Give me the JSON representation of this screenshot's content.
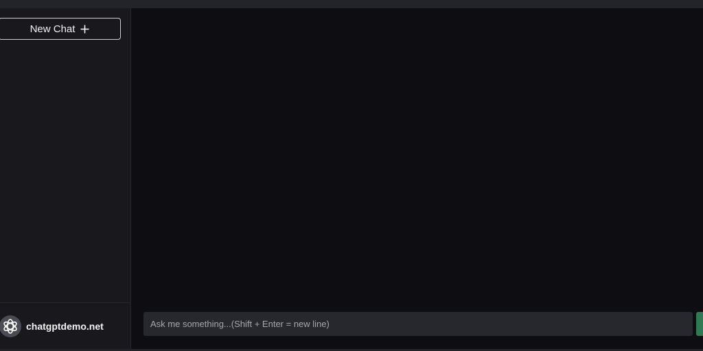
{
  "sidebar": {
    "new_chat_label": "New Chat",
    "new_chat_icon": "plus-icon",
    "brand_name": "chatgptdemo.net",
    "logo_icon": "openai-logo-icon"
  },
  "composer": {
    "placeholder": "Ask me something...(Shift + Enter = new line)",
    "value": "",
    "send_color": "#2f7a55"
  },
  "colors": {
    "background": "#0e0e12",
    "sidebar": "#18181d",
    "input": "#27282d",
    "accent": "#2f7a55"
  }
}
